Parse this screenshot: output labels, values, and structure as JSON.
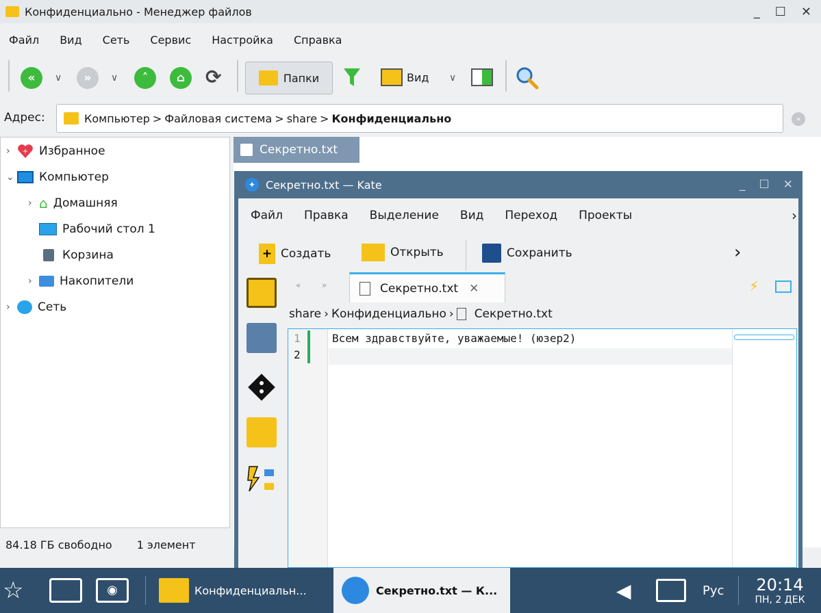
{
  "fm": {
    "title": "Конфиденциально - Менеджер файлов",
    "menu": [
      "Файл",
      "Вид",
      "Сеть",
      "Сервис",
      "Настройка",
      "Справка"
    ],
    "toolbar": {
      "folders_label": "Папки",
      "view_label": "Вид"
    },
    "address": {
      "label": "Адрес:",
      "crumbs": [
        "Компьютер",
        "Файловая система",
        "share",
        "Конфиденциально"
      ]
    },
    "tree": {
      "favorites": "Избранное",
      "computer": "Компьютер",
      "home": "Домашняя",
      "desktop": "Рабочий стол 1",
      "trash": "Корзина",
      "drives": "Накопители",
      "network": "Сеть"
    },
    "status": {
      "free": "84.18 ГБ свободно",
      "count": "1 элемент"
    },
    "file_item": "Секретно.txt"
  },
  "kate": {
    "title": "Секретно.txt — Kate",
    "menu": [
      "Файл",
      "Правка",
      "Выделение",
      "Вид",
      "Переход",
      "Проекты"
    ],
    "toolbar": {
      "new": "Создать",
      "open": "Открыть",
      "save": "Сохранить"
    },
    "tab": "Секретно.txt",
    "crumbs": [
      "share",
      "Конфиденциально",
      "Секретно.txt"
    ],
    "lines": [
      "1",
      "2"
    ],
    "code": "Всем здравствуйте, уважаемые! (юзер2)"
  },
  "taskbar": {
    "task_fm": "Конфиденциальн...",
    "task_kate": "Секретно.txt — К...",
    "lang": "Рус",
    "time": "20:14",
    "date": "ПН, 2 ДЕК"
  },
  "colors": {
    "accent": "#3daee9",
    "taskbar": "#2f4e6b",
    "kate_frame": "#4e6f8c",
    "green": "#3dbb3d",
    "folder": "#f5c21a"
  }
}
